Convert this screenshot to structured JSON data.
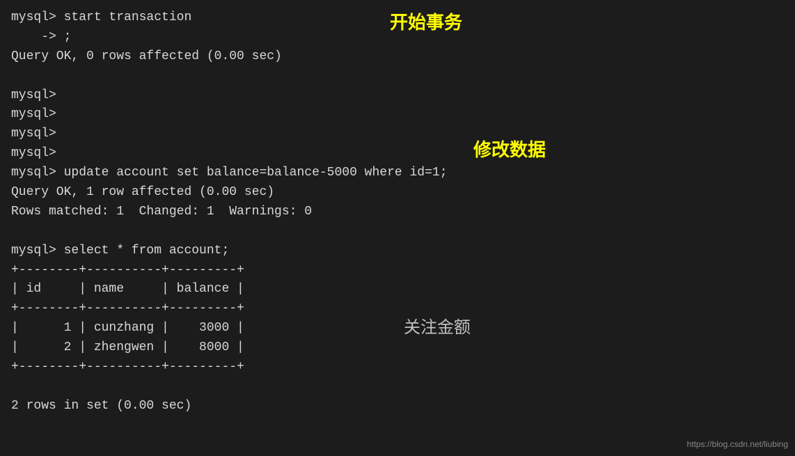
{
  "terminal": {
    "lines": [
      {
        "id": "line1",
        "text": "mysql> start transaction",
        "type": "prompt"
      },
      {
        "id": "line2",
        "text": "    -> ;",
        "type": "prompt"
      },
      {
        "id": "line3",
        "text": "Query OK, 0 rows affected (0.00 sec)",
        "type": "result"
      },
      {
        "id": "line4",
        "text": "",
        "type": "blank"
      },
      {
        "id": "line5",
        "text": "mysql>",
        "type": "prompt"
      },
      {
        "id": "line6",
        "text": "mysql>",
        "type": "prompt"
      },
      {
        "id": "line7",
        "text": "mysql>",
        "type": "prompt"
      },
      {
        "id": "line8",
        "text": "mysql>",
        "type": "prompt"
      },
      {
        "id": "line9",
        "text": "mysql> update account set balance=balance-5000 where id=1;",
        "type": "prompt"
      },
      {
        "id": "line10",
        "text": "Query OK, 1 row affected (0.00 sec)",
        "type": "result"
      },
      {
        "id": "line11",
        "text": "Rows matched: 1  Changed: 1  Warnings: 0",
        "type": "result"
      },
      {
        "id": "line12",
        "text": "",
        "type": "blank"
      },
      {
        "id": "line13",
        "text": "mysql> select * from account;",
        "type": "prompt"
      },
      {
        "id": "line14",
        "text": "+--------+----------+---------+",
        "type": "table-border"
      },
      {
        "id": "line15",
        "text": "| id     | name     | balance |",
        "type": "table-header"
      },
      {
        "id": "line16",
        "text": "+--------+----------+---------+",
        "type": "table-border"
      },
      {
        "id": "line17",
        "text": "|      1 | cunzhang |    3000 |",
        "type": "table-row"
      },
      {
        "id": "line18",
        "text": "|      2 | zhengwen |    8000 |",
        "type": "table-row"
      },
      {
        "id": "line19",
        "text": "+--------+----------+---------+",
        "type": "table-border"
      },
      {
        "id": "line20",
        "text": "",
        "type": "blank"
      },
      {
        "id": "line21",
        "text": "2 rows in set (0.00 sec)",
        "type": "result"
      }
    ]
  },
  "annotations": {
    "start_transaction": "开始事务",
    "modify_data": "修改数据",
    "focus_amount": "关注金额"
  },
  "watermark": "https://blog.csdn.net/liubing"
}
